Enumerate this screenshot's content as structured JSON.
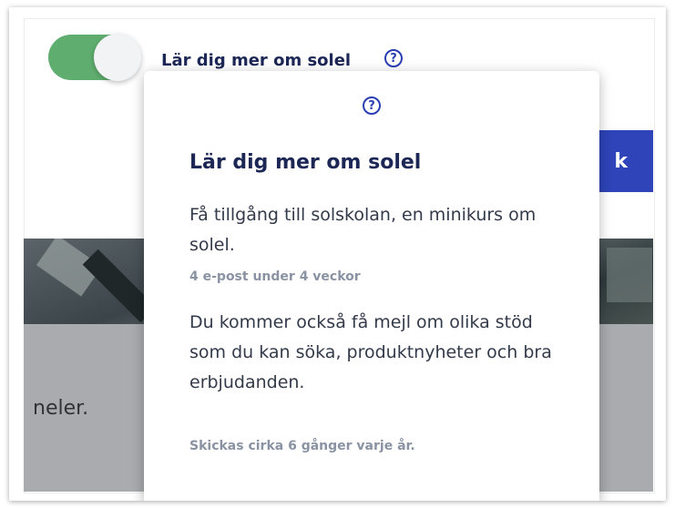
{
  "toggle": {
    "label": "Lär dig mer om solel",
    "checked": true,
    "color": "#5fae6f"
  },
  "help_icon_glyph": "?",
  "background": {
    "button_partial_label": "k",
    "partial_text": "neler."
  },
  "popup": {
    "title": "Lär dig mer om solel",
    "paragraph_1": "Få tillgång till solskolan, en minikurs om solel.",
    "note_1": "4 e-post under 4 veckor",
    "paragraph_2": "Du kommer också få mejl om olika stöd som du kan söka, produktnyheter och bra erbjudanden.",
    "note_2": "Skickas cirka 6 gånger varje år."
  },
  "colors": {
    "accent_blue": "#2e44b8",
    "title_navy": "#1c2756"
  }
}
